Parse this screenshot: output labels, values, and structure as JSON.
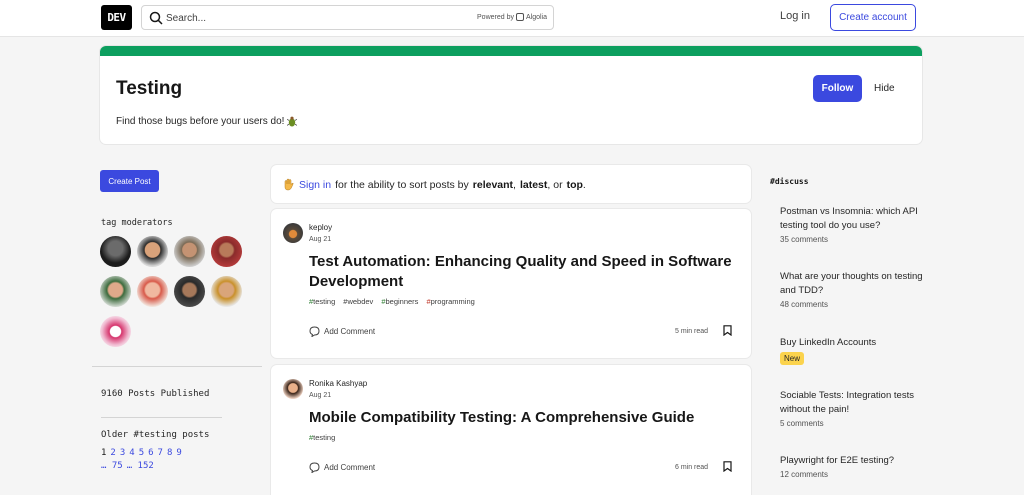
{
  "header": {
    "logo": "DEV",
    "search_placeholder": "Search...",
    "powered_by": "Powered by",
    "algolia": "Algolia",
    "login": "Log in",
    "create_account": "Create account"
  },
  "tag": {
    "title": "Testing",
    "description": "Find those bugs before your users do!",
    "follow": "Follow",
    "hide": "Hide",
    "accent_color": "#0d9f5f"
  },
  "sidebar": {
    "create_post": "Create Post",
    "moderators_title": "tag moderators",
    "posts_published": "9160 Posts Published",
    "older_posts": "Older #testing posts",
    "pages": [
      "1",
      "2",
      "3",
      "4",
      "5",
      "6",
      "7",
      "8",
      "9",
      "… 75",
      "… 152"
    ]
  },
  "sort_banner": {
    "sign_in": "Sign in",
    "text_1": "for the ability to sort posts by",
    "relevant": "relevant",
    "sep": ",",
    "latest": "latest",
    "text_2": ", or",
    "top": "top",
    "end": "."
  },
  "posts": [
    {
      "author": "keploy",
      "date": "Aug 21",
      "title": "Test Automation: Enhancing Quality and Speed in Software Development",
      "tags": [
        "testing",
        "webdev",
        "beginners",
        "programming"
      ],
      "comment_label": "Add Comment",
      "read_time": "5 min read"
    },
    {
      "author": "Ronika Kashyap",
      "date": "Aug 21",
      "title": "Mobile Compatibility Testing: A Comprehensive Guide",
      "tags": [
        "testing"
      ],
      "comment_label": "Add Comment",
      "read_time": "6 min read"
    }
  ],
  "discuss": {
    "heading": "#discuss",
    "items": [
      {
        "title": "Postman vs Insomnia: which API testing tool do you use?",
        "count": "35 comments"
      },
      {
        "title": "What are your thoughts on testing and TDD?",
        "count": "48 comments"
      },
      {
        "title": "Buy LinkedIn Accounts",
        "badge": "New"
      },
      {
        "title": "Sociable Tests: Integration tests without the pain!",
        "count": "5 comments"
      },
      {
        "title": "Playwright for E2E testing?",
        "count": "12 comments"
      }
    ]
  }
}
